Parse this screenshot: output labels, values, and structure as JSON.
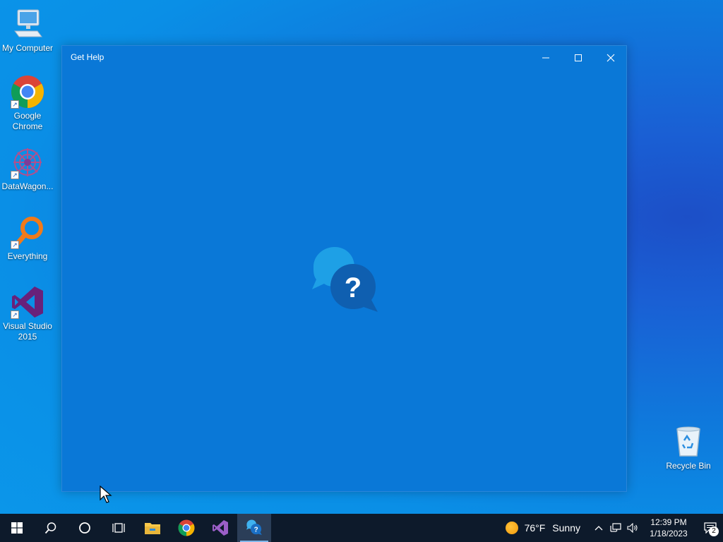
{
  "desktop": {
    "icons": [
      {
        "label": "My Computer"
      },
      {
        "label": "Google Chrome"
      },
      {
        "label": "DataWagon..."
      },
      {
        "label": "Everything"
      },
      {
        "label": "Visual Studio 2015"
      },
      {
        "label": "Recycle Bin"
      }
    ]
  },
  "window": {
    "title": "Get Help",
    "logo_icon": "get-help-question-bubbles-icon"
  },
  "taskbar": {
    "apps": [
      "start",
      "search",
      "task-view",
      "cortana",
      "file-explorer",
      "chrome",
      "visual-studio",
      "get-help"
    ],
    "weather": {
      "temp": "76°F",
      "condition": "Sunny"
    },
    "clock": {
      "time": "12:39 PM",
      "date": "1/18/2023"
    },
    "notifications_count": "2"
  },
  "colors": {
    "window_bg": "#0a78d7",
    "taskbar_bg": "#0d1a2b"
  }
}
